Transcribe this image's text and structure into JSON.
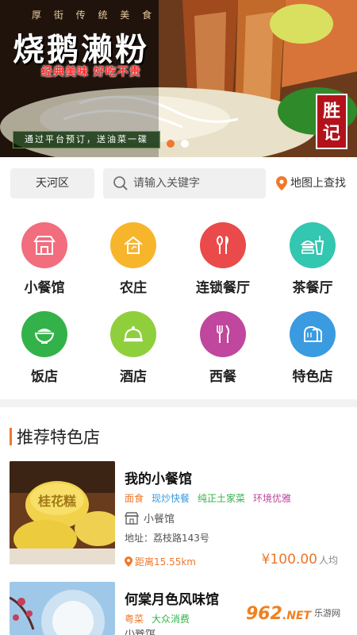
{
  "banner": {
    "tagline_top": "厚 街 传 统 美 食",
    "title": "烧鹅濑粉",
    "subtitle": "经典美味 好吃不贵",
    "promo": "通过平台预订，送油菜一碟",
    "stamp": "胜记",
    "slides": 2,
    "active_slide": 0
  },
  "search": {
    "district": "天河区",
    "placeholder": "请输入关键字",
    "map_link": "地图上查找"
  },
  "categories": [
    {
      "label": "小餐馆",
      "color": "#f26d7d",
      "icon": "storefront-icon"
    },
    {
      "label": "农庄",
      "color": "#f7b52c",
      "icon": "farmhouse-icon"
    },
    {
      "label": "连锁餐厅",
      "color": "#ea4a4a",
      "icon": "spoon-fork-icon"
    },
    {
      "label": "茶餐厅",
      "color": "#33c6b0",
      "icon": "fast-food-icon"
    },
    {
      "label": "饭店",
      "color": "#33b24a",
      "icon": "rice-bowl-icon"
    },
    {
      "label": "酒店",
      "color": "#8fcf3c",
      "icon": "cloche-icon"
    },
    {
      "label": "西餐",
      "color": "#c0479d",
      "icon": "knife-fork-icon"
    },
    {
      "label": "特色店",
      "color": "#3a9be0",
      "icon": "bread-icon"
    }
  ],
  "section": {
    "title": "推荐特色店"
  },
  "shops": [
    {
      "name": "我的小餐馆",
      "tags": [
        {
          "text": "面食",
          "color": "#f0782c"
        },
        {
          "text": "现炒快餐",
          "color": "#3a9be0"
        },
        {
          "text": "纯正土家菜",
          "color": "#33b24a"
        },
        {
          "text": "环境优雅",
          "color": "#c0479d"
        }
      ],
      "type": "小餐馆",
      "address": "地址：荔枝路143号",
      "distance": "距离15.55km",
      "price": "¥100.00",
      "price_unit": "人均",
      "thumb_text": "桂花糕"
    },
    {
      "name": "何棠月色风味馆",
      "tags": [
        {
          "text": "粤菜",
          "color": "#f0782c"
        },
        {
          "text": "大众消费",
          "color": "#33b24a"
        }
      ],
      "type": "小餐馆"
    }
  ],
  "watermark": {
    "brand": "962",
    "suffix": ".NET",
    "cn": "乐游网"
  }
}
